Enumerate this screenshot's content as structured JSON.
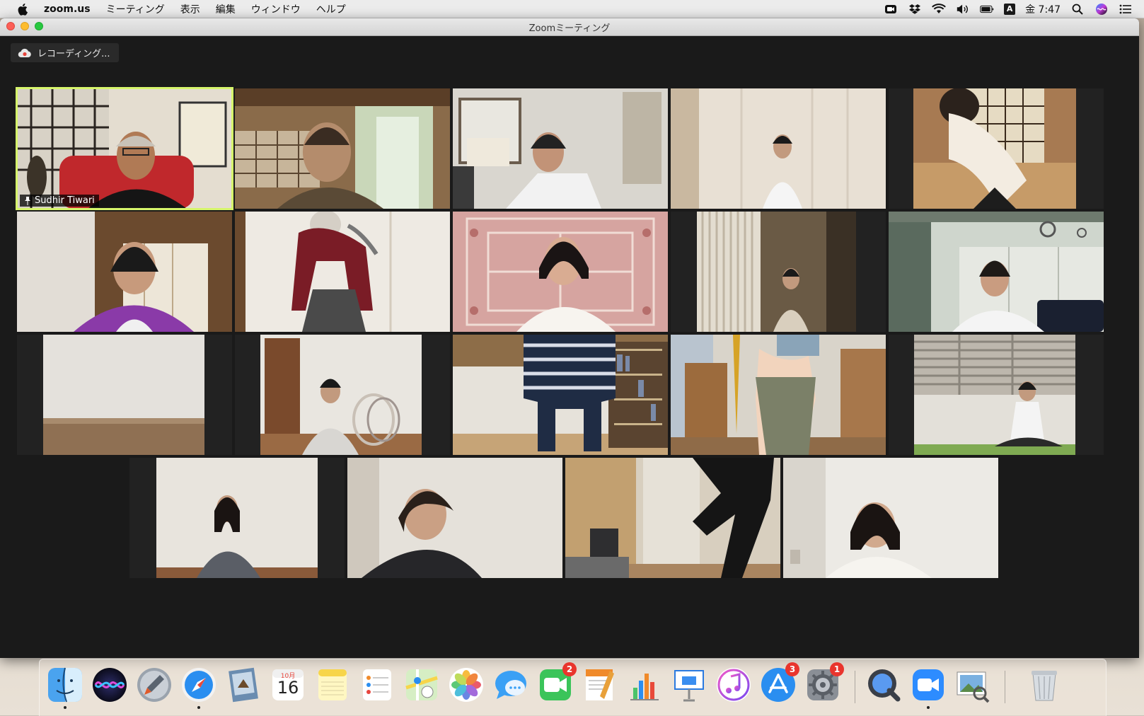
{
  "menubar": {
    "app_name": "zoom.us",
    "menus": [
      "ミーティング",
      "表示",
      "編集",
      "ウィンドウ",
      "ヘルプ"
    ],
    "input_source": "A",
    "clock": "金 7:47"
  },
  "window": {
    "title": "Zoomミーティング",
    "recording_label": "レコーディング..."
  },
  "participants": {
    "active_speaker_name": "Sudhir Tiwari"
  },
  "dock": {
    "calendar_month": "10月",
    "calendar_day": "16",
    "badges": {
      "facetime": "2",
      "appstore": "3",
      "preferences": "1"
    }
  },
  "colors": {
    "active_speaker_border": "#d6f56b",
    "window_background": "#1a1a1a",
    "badge": "#e9352d"
  }
}
